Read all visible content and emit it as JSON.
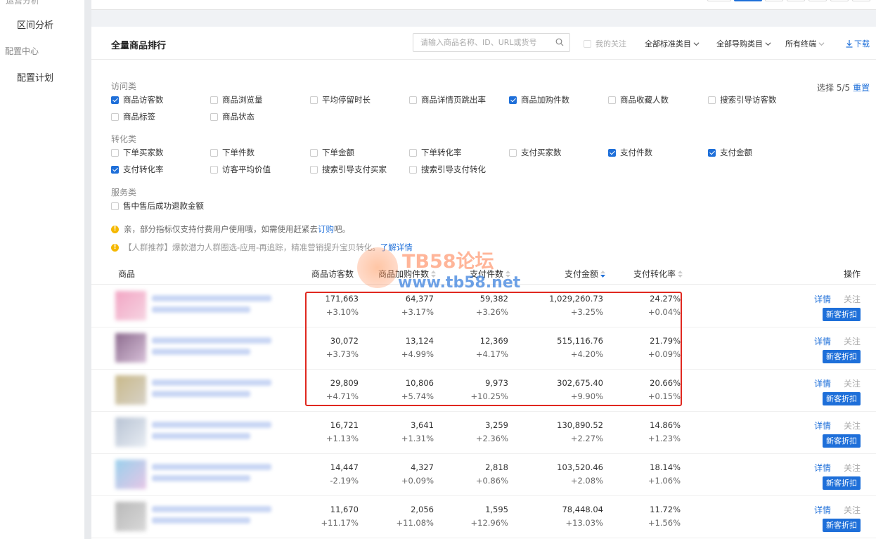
{
  "sidebar": {
    "partial_label": "运营分析",
    "item_range": "区间分析",
    "group_config": "配置中心",
    "item_plan": "配置计划"
  },
  "card": {
    "title": "全量商品排行",
    "search_placeholder": "请输入商品名称、ID、URL或货号",
    "my_follow": "我的关注",
    "dropdowns": [
      "全部标准类目",
      "全部导购类目",
      "所有终端"
    ],
    "download": "下载",
    "select_count": "选择 5/5",
    "reset": "重置"
  },
  "metrics": {
    "visit_label": "访问类",
    "visit": [
      {
        "label": "商品访客数",
        "checked": true
      },
      {
        "label": "商品浏览量",
        "checked": false
      },
      {
        "label": "平均停留时长",
        "checked": false
      },
      {
        "label": "商品详情页跳出率",
        "checked": false
      },
      {
        "label": "商品加购件数",
        "checked": true
      },
      {
        "label": "商品收藏人数",
        "checked": false
      },
      {
        "label": "搜索引导访客数",
        "checked": false
      },
      {
        "label": "商品标签",
        "checked": false
      },
      {
        "label": "商品状态",
        "checked": false
      }
    ],
    "conv_label": "转化类",
    "conv": [
      {
        "label": "下单买家数",
        "checked": false
      },
      {
        "label": "下单件数",
        "checked": false
      },
      {
        "label": "下单金额",
        "checked": false
      },
      {
        "label": "下单转化率",
        "checked": false
      },
      {
        "label": "支付买家数",
        "checked": false
      },
      {
        "label": "支付件数",
        "checked": true
      },
      {
        "label": "支付金额",
        "checked": true
      },
      {
        "label": "支付转化率",
        "checked": true
      },
      {
        "label": "访客平均价值",
        "checked": false
      },
      {
        "label": "搜索引导支付买家",
        "checked": false
      },
      {
        "label": "搜索引导支付转化",
        "checked": false
      }
    ],
    "service_label": "服务类",
    "service": [
      {
        "label": "售中售后成功退款金额",
        "checked": false
      }
    ]
  },
  "notices": {
    "n1_pre": "亲，部分指标仅支持付费用户使用哦，如需使用赶紧去",
    "n1_link": "订购",
    "n1_post": "吧。",
    "n2_text": "【人群推荐】爆款潜力人群圈选-应用-再追踪，精准营销提升宝贝转化。",
    "n2_link": "了解详情"
  },
  "table": {
    "headers": {
      "product": "商品",
      "visitors": "商品访客数",
      "cart": "商品加购件数",
      "paid_items": "支付件数",
      "paid_amount": "支付金额",
      "pay_rate": "支付转化率",
      "ops": "操作"
    },
    "op_detail": "详情",
    "op_follow": "关注",
    "op_promo": "新客折扣",
    "rows": [
      {
        "visitors": "171,663",
        "visitors_d": "+3.10%",
        "cart": "64,377",
        "cart_d": "+3.17%",
        "paid_items": "59,382",
        "paid_items_d": "+3.26%",
        "paid_amount": "1,029,260.73",
        "paid_amount_d": "+3.25%",
        "pay_rate": "24.27%",
        "pay_rate_d": "+0.04%"
      },
      {
        "visitors": "30,072",
        "visitors_d": "+3.73%",
        "cart": "13,124",
        "cart_d": "+4.99%",
        "paid_items": "12,369",
        "paid_items_d": "+4.17%",
        "paid_amount": "515,116.76",
        "paid_amount_d": "+4.20%",
        "pay_rate": "21.79%",
        "pay_rate_d": "+0.09%"
      },
      {
        "visitors": "29,809",
        "visitors_d": "+4.71%",
        "cart": "10,806",
        "cart_d": "+5.74%",
        "paid_items": "9,973",
        "paid_items_d": "+10.25%",
        "paid_amount": "302,675.40",
        "paid_amount_d": "+9.90%",
        "pay_rate": "20.66%",
        "pay_rate_d": "+0.15%"
      },
      {
        "visitors": "16,721",
        "visitors_d": "+1.13%",
        "cart": "3,641",
        "cart_d": "+1.31%",
        "paid_items": "3,259",
        "paid_items_d": "+2.36%",
        "paid_amount": "130,890.52",
        "paid_amount_d": "+2.27%",
        "pay_rate": "14.86%",
        "pay_rate_d": "+1.23%"
      },
      {
        "visitors": "14,447",
        "visitors_d": "-2.19%",
        "cart": "4,327",
        "cart_d": "+0.09%",
        "paid_items": "2,818",
        "paid_items_d": "+0.86%",
        "paid_amount": "103,520.46",
        "paid_amount_d": "+2.08%",
        "pay_rate": "18.14%",
        "pay_rate_d": "+1.06%"
      },
      {
        "visitors": "11,670",
        "visitors_d": "+11.17%",
        "cart": "2,056",
        "cart_d": "+11.08%",
        "paid_items": "1,595",
        "paid_items_d": "+12.96%",
        "paid_amount": "78,448.04",
        "paid_amount_d": "+13.03%",
        "pay_rate": "11.72%",
        "pay_rate_d": "+1.56%"
      }
    ]
  },
  "watermark": {
    "line1": "TB58论坛",
    "line2": "www.tb58.net"
  },
  "colors": {
    "accent": "#1e6fd9",
    "highlight": "#e0281f",
    "notice": "#f5b800"
  }
}
